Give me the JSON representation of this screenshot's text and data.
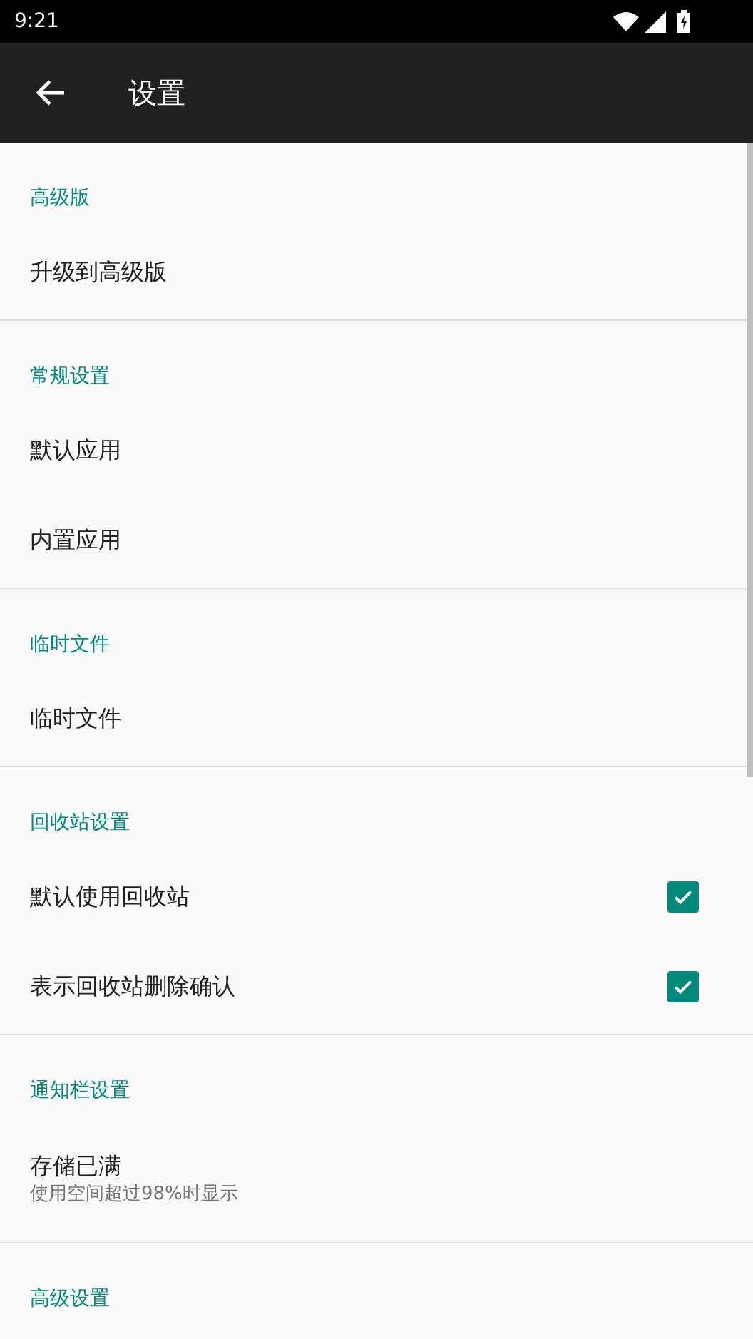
{
  "status_bar": {
    "time": "9:21"
  },
  "app_bar": {
    "title": "设置"
  },
  "sections": [
    {
      "header": "高级版",
      "items": [
        {
          "kind": "plain",
          "title": "升级到高级版"
        }
      ]
    },
    {
      "header": "常规设置",
      "items": [
        {
          "kind": "plain",
          "title": "默认应用"
        },
        {
          "kind": "plain",
          "title": "内置应用"
        }
      ]
    },
    {
      "header": "临时文件",
      "items": [
        {
          "kind": "plain",
          "title": "临时文件"
        }
      ]
    },
    {
      "header": "回收站设置",
      "items": [
        {
          "kind": "checkbox",
          "title": "默认使用回收站",
          "checked": true
        },
        {
          "kind": "checkbox",
          "title": "表示回收站删除确认",
          "checked": true
        }
      ]
    },
    {
      "header": "通知栏设置",
      "items": [
        {
          "kind": "plain",
          "title": "存储已满",
          "summary": "使用空间超过98%时显示"
        }
      ]
    },
    {
      "header": "高级设置"
    }
  ]
}
